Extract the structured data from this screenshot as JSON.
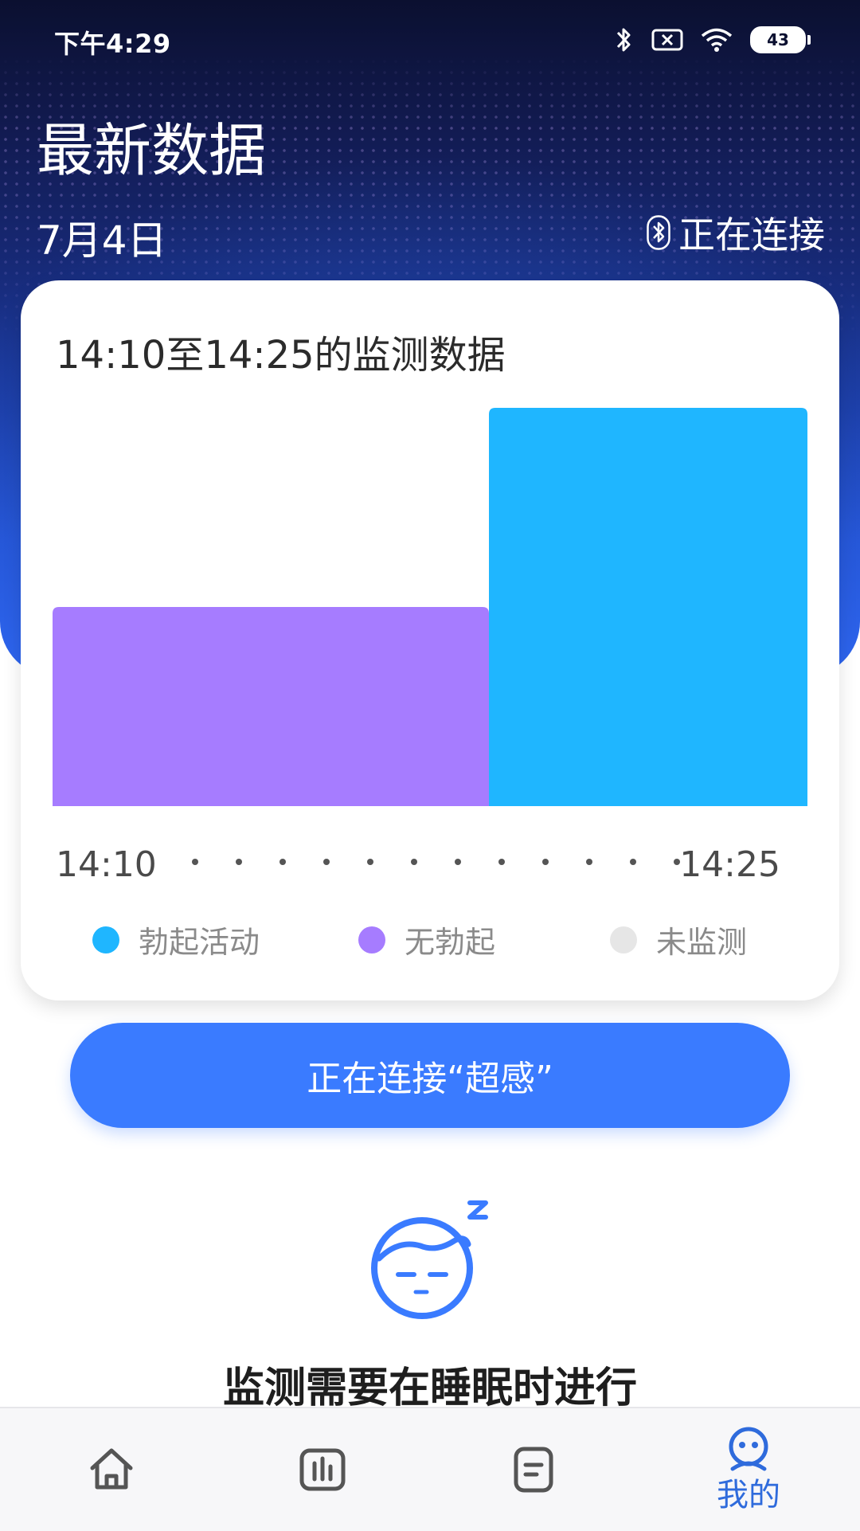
{
  "status_bar": {
    "time": "下午4:29",
    "battery": "43",
    "icons": [
      "bluetooth-icon",
      "sim-error-icon",
      "wifi-icon",
      "battery-icon"
    ]
  },
  "header": {
    "title": "最新数据",
    "date": "7月4日",
    "connection_status": "正在连接"
  },
  "card": {
    "title": "14:10至14:25的监测数据",
    "axis_start": "14:10",
    "axis_end": "14:25",
    "legend": [
      {
        "label": "勃起活动",
        "color": "#1fb6ff"
      },
      {
        "label": "无勃起",
        "color": "#a67cff"
      },
      {
        "label": "未监测",
        "color": "#e6e6e6"
      }
    ]
  },
  "chart_data": {
    "type": "bar",
    "series": [
      {
        "label": "无勃起",
        "start": "14:10",
        "level": 0.5,
        "color": "#a67cff"
      },
      {
        "label": "勃起活动",
        "level": 1.0,
        "color": "#1fb6ff"
      }
    ]
  },
  "connect_button": {
    "label": "正在连接“超感”"
  },
  "hint": {
    "text": "监测需要在睡眠时进行"
  },
  "tabbar": {
    "items": [
      {
        "icon": "home-icon"
      },
      {
        "icon": "chart-icon"
      },
      {
        "icon": "document-icon"
      },
      {
        "icon": "profile-icon",
        "label": "我的"
      }
    ],
    "active_color": "#2f6bdc",
    "inactive_color": "#555555"
  }
}
